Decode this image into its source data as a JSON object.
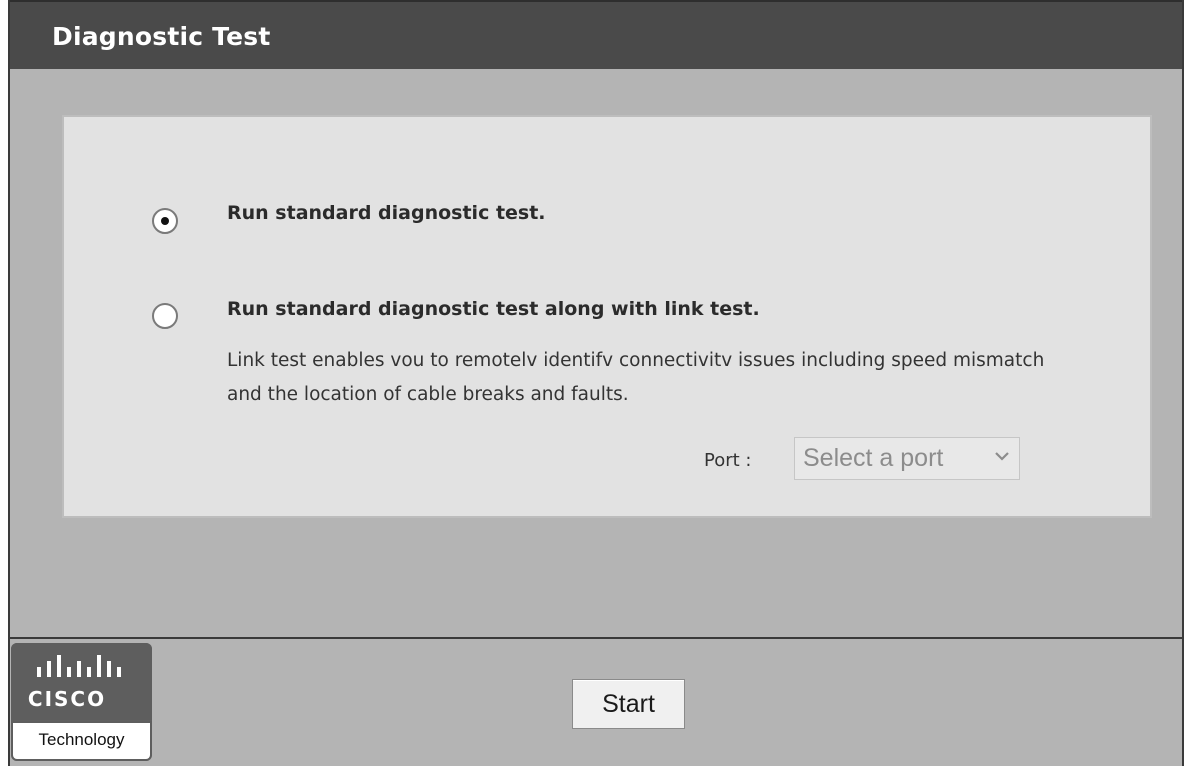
{
  "window": {
    "title": "Diagnostic Test"
  },
  "options": [
    {
      "label": "Run standard diagnostic test.",
      "selected": true
    },
    {
      "label": "Run standard diagnostic test along with link test.",
      "selected": false
    }
  ],
  "link_test": {
    "description": "Link test enables vou to remotelv identifv connectivitv issues including speed mismatch and the location of cable breaks and faults."
  },
  "port": {
    "label": "Port :",
    "select_value": "Select a port"
  },
  "footer": {
    "start_label": "Start"
  },
  "logo": {
    "wordmark": "CISCO",
    "tagline": "Technology"
  },
  "colors": {
    "titlebar": "#4a4a4a",
    "background": "#b4b4b4",
    "panel": "#e2e2e2"
  }
}
